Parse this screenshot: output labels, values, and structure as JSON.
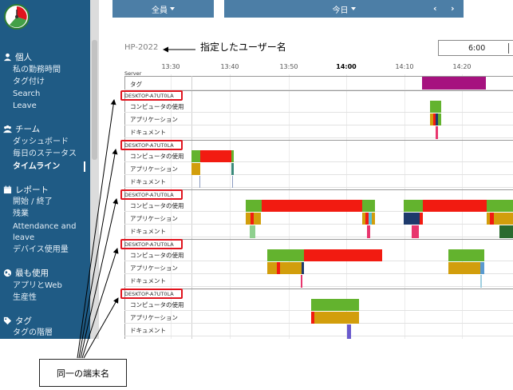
{
  "sidebar": {
    "sections": [
      {
        "label": "個人",
        "icon": "user-icon",
        "items": [
          "私の勤務時間",
          "タグ付け",
          "Search",
          "Leave"
        ]
      },
      {
        "label": "チーム",
        "icon": "team-icon",
        "items": [
          "ダッシュボード",
          "毎日のステータス",
          "タイムライン"
        ]
      },
      {
        "label": "レポート",
        "icon": "calendar-icon",
        "items": [
          "開始 / 終了",
          "残業",
          "Attendance and",
          "leave",
          "デバイス使用量"
        ]
      },
      {
        "label": "最も使用",
        "icon": "globe-icon",
        "items": [
          "アプリとWeb",
          "生産性"
        ]
      },
      {
        "label": "タグ",
        "icon": "tag-icon",
        "items": [
          "タグの階層"
        ]
      }
    ],
    "active_item": "タイムライン"
  },
  "topbar": {
    "member_filter": "全員",
    "date_filter": "今日",
    "prev_label": "‹",
    "next_label": "›"
  },
  "chart": {
    "user_name": "HP-2022",
    "time_box_label": "6:00",
    "server_label": "Server",
    "tag_row_label": "タグ",
    "ticks": [
      "13:30",
      "13:40",
      "13:50",
      "14:00",
      "14:10",
      "14:20"
    ],
    "device_label": "DESKTOP-A7UT0LA",
    "row_labels": [
      "コンピュータの使用",
      "アプリケーション",
      "ドキュメント"
    ],
    "colors": {
      "active": "#63b32e",
      "idle": "#f21b11",
      "tag": "#a6127f",
      "app_gold": "#d29e0c",
      "app_navy": "#1d3a6c",
      "doc_pink": "#e8366e",
      "annotation": "#e0141e"
    }
  },
  "annotations": {
    "callout_top": "指定したユーザー名",
    "callout_bottom": "同一の端末名"
  }
}
